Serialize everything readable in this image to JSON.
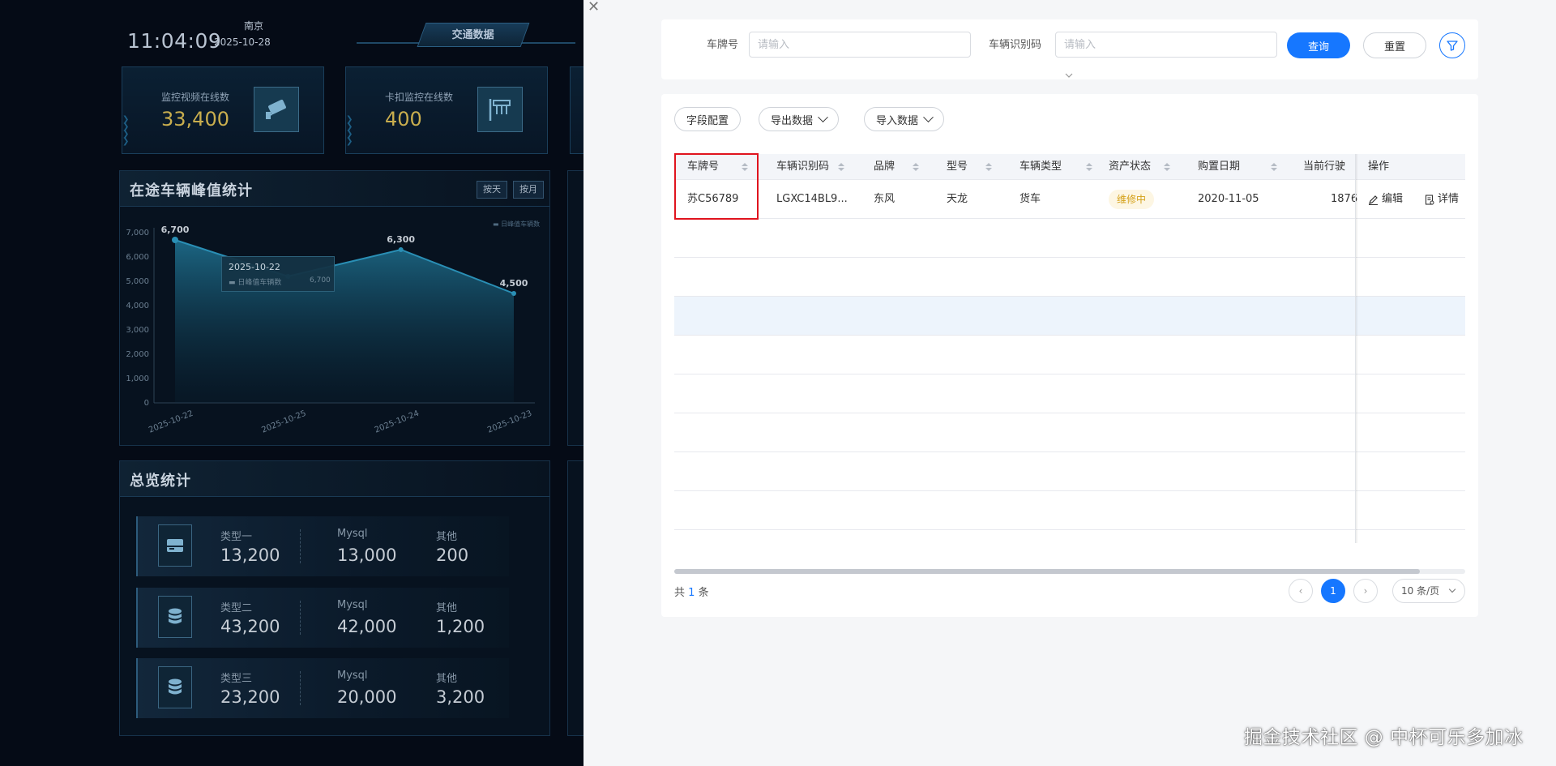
{
  "dashboard": {
    "time": "11:04:09",
    "city": "南京",
    "date": "2025-10-28",
    "tab": "交通数据",
    "kpis": [
      {
        "label": "监控视频在线数",
        "value": "33,400",
        "icon": "camera-icon"
      },
      {
        "label": "卡扣监控在线数",
        "value": "400",
        "icon": "gate-icon"
      }
    ],
    "peak_panel": {
      "title": "在途车辆峰值统计",
      "seg_day": "按天",
      "seg_month": "按月",
      "legend": "日峰值车辆数",
      "tooltip": {
        "date": "2025-10-22",
        "name": "日峰值车辆数",
        "value": "6,700"
      }
    },
    "total_panel": {
      "title": "总览统计",
      "rows": [
        {
          "c1_label": "类型一",
          "c1_value": "13,200",
          "c2_label": "Mysql",
          "c2_value": "13,000",
          "c3_label": "其他",
          "c3_value": "200",
          "icon": "card-icon"
        },
        {
          "c1_label": "类型二",
          "c1_value": "43,200",
          "c2_label": "Mysql",
          "c2_value": "42,000",
          "c3_label": "其他",
          "c3_value": "1,200",
          "icon": "database-icon"
        },
        {
          "c1_label": "类型三",
          "c1_value": "23,200",
          "c2_label": "Mysql",
          "c2_value": "20,000",
          "c3_label": "其他",
          "c3_value": "3,200",
          "icon": "database-icon"
        }
      ]
    }
  },
  "chart_data": {
    "type": "area",
    "title": "在途车辆峰值统计",
    "categories": [
      "2025-10-22",
      "2025-10-25",
      "2025-10-24",
      "2025-10-23"
    ],
    "series": [
      {
        "name": "日峰值车辆数",
        "values": [
          6700,
          5200,
          6300,
          4500
        ]
      }
    ],
    "data_labels": [
      "6,700",
      "",
      "6,300",
      "4,500"
    ],
    "ylim": [
      0,
      7000
    ],
    "yticks": [
      "0",
      "1,000",
      "2,000",
      "3,000",
      "4,000",
      "5,000",
      "6,000",
      "7,000"
    ],
    "grid": false,
    "legend": "top-right",
    "color": "#2a8fb5"
  },
  "search": {
    "plate_label": "车牌号",
    "plate_placeholder": "请输入",
    "vin_label": "车辆识别码",
    "vin_placeholder": "请输入",
    "query": "查询",
    "reset": "重置"
  },
  "toolbar": {
    "field_config": "字段配置",
    "export": "导出数据",
    "import": "导入数据"
  },
  "table": {
    "columns": [
      "车牌号",
      "车辆识别码",
      "品牌",
      "型号",
      "车辆类型",
      "资产状态",
      "购置日期",
      "当前行驶",
      "操作"
    ],
    "rows": [
      {
        "plate": "苏C56789",
        "vin": "LGXC14BL9...",
        "brand": "东风",
        "model": "天龙",
        "vtype": "货车",
        "status": "维修中",
        "date": "2020-11-05",
        "mileage": "1876"
      }
    ],
    "actions": {
      "edit": "编辑",
      "detail": "详情"
    }
  },
  "pagination": {
    "total_prefix": "共",
    "total": "1",
    "total_suffix": "条",
    "current": "1",
    "prev": "‹",
    "next": "›",
    "page_size": "10 条/页"
  },
  "watermark": "掘金技术社区 @ 中杯可乐多加冰",
  "colors": {
    "primary": "#1677ff",
    "warning_bg": "#fdf6e3",
    "warning_text": "#d4a017",
    "highlight": "#e0141e"
  }
}
